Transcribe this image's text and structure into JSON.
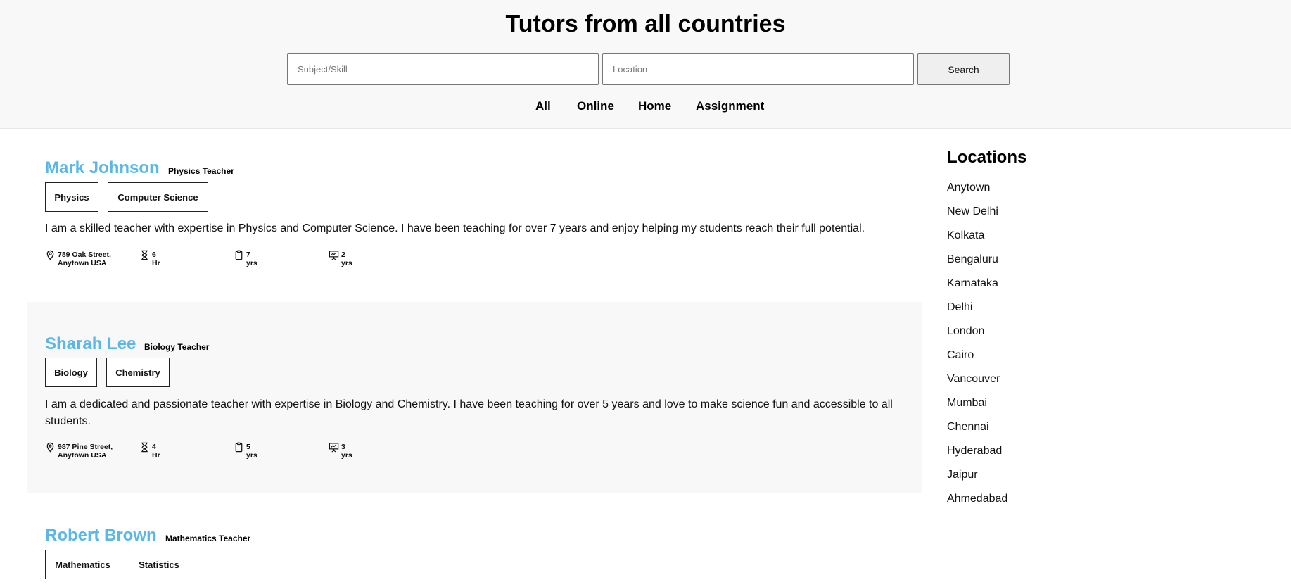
{
  "header": {
    "title": "Tutors from all countries",
    "subject_placeholder": "Subject/Skill",
    "location_placeholder": "Location",
    "search_label": "Search",
    "filters": [
      "All",
      "Online",
      "Home",
      "Assignment"
    ]
  },
  "tutors": [
    {
      "name": "Mark Johnson",
      "role": "Physics Teacher",
      "tags": [
        "Physics",
        "Computer Science"
      ],
      "bio": "I am a skilled teacher with expertise in Physics and Computer Science. I have been teaching for over 7 years and enjoy helping my students reach their full potential.",
      "address_line1": "789 Oak Street,",
      "address_line2": "Anytown USA",
      "hours": "6 Hr",
      "experience": "7 yrs",
      "online_experience": "2 yrs"
    },
    {
      "name": "Sharah Lee",
      "role": "Biology Teacher",
      "tags": [
        "Biology",
        "Chemistry"
      ],
      "bio": "I am a dedicated and passionate teacher with expertise in Biology and Chemistry. I have been teaching for over 5 years and love to make science fun and accessible to all students.",
      "address_line1": "987 Pine Street,",
      "address_line2": "Anytown USA",
      "hours": "4 Hr",
      "experience": "5 yrs",
      "online_experience": "3 yrs"
    },
    {
      "name": "Robert Brown",
      "role": "Mathematics Teacher",
      "tags": [
        "Mathematics",
        "Statistics"
      ]
    }
  ],
  "locations": {
    "title": "Locations",
    "items": [
      "Anytown",
      "New Delhi",
      "Kolkata",
      "Bengaluru",
      "Karnataka",
      "Delhi",
      "London",
      "Cairo",
      "Vancouver",
      "Mumbai",
      "Chennai",
      "Hyderabad",
      "Jaipur",
      "Ahmedabad"
    ]
  }
}
